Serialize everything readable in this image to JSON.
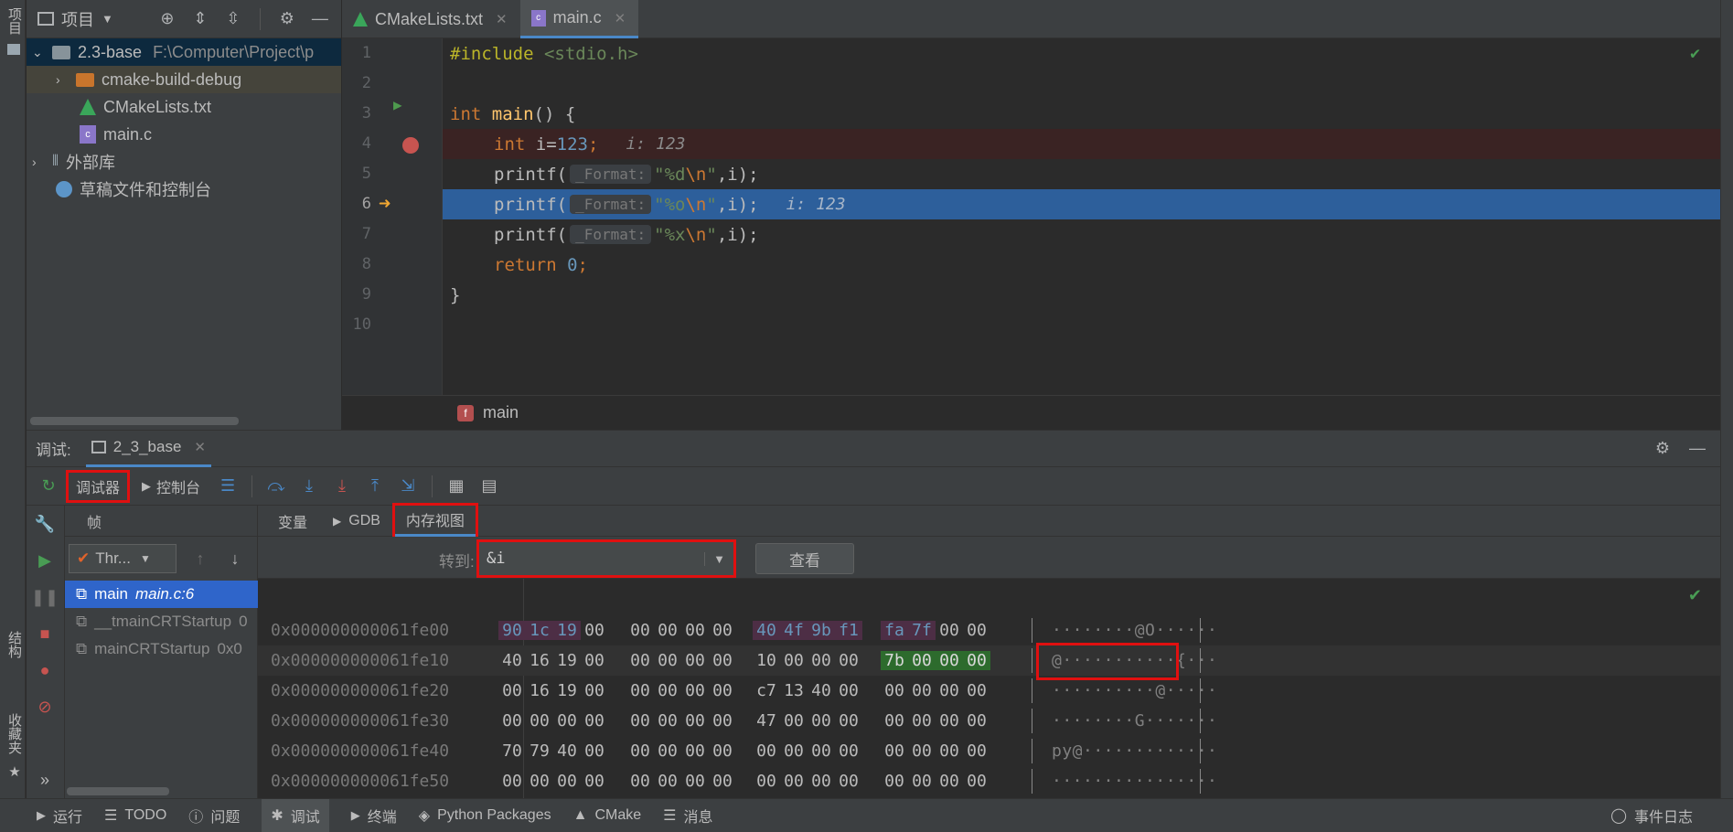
{
  "sidebar_tabs": {
    "project": "项目",
    "structure": "结构",
    "favorites": "收藏夹"
  },
  "project": {
    "title": "项目",
    "tree": [
      {
        "label": "2.3-base",
        "path": "F:\\Computer\\Project\\p"
      },
      {
        "label": "cmake-build-debug"
      },
      {
        "label": "CMakeLists.txt"
      },
      {
        "label": "main.c"
      },
      {
        "label": "外部库"
      },
      {
        "label": "草稿文件和控制台"
      }
    ]
  },
  "editor": {
    "tabs": [
      {
        "label": "CMakeLists.txt"
      },
      {
        "label": "main.c"
      }
    ],
    "line_numbers": [
      "1",
      "2",
      "3",
      "4",
      "5",
      "6",
      "7",
      "8",
      "9",
      "10"
    ],
    "param_hint": "_Format:",
    "inline_i": "i: 123",
    "breadcrumb": "main",
    "code": {
      "l1_dir": "#include ",
      "l1_hdr": "<stdio.h>",
      "l3_kw": "int ",
      "l3_fn": "main",
      "l3_rest": "() {",
      "l4_kw": "int ",
      "l4_var": "i=",
      "l4_num": "123",
      "l4_semi": ";",
      "printf": "printf(",
      "fmt_d": "\"%d",
      "fmt_o": "\"%o",
      "fmt_x": "\"%x",
      "esc_n": "\\n",
      "fmt_close": "\"",
      "args_end": ",i);",
      "ret_kw": "return ",
      "ret_num": "0",
      "ret_semi": ";",
      "close_brace": "}"
    }
  },
  "debug": {
    "label": "调试:",
    "session_tab": "2_3_base",
    "toolbar": {
      "debugger": "调试器",
      "console": "控制台"
    },
    "frames_header": "帧",
    "thread_select": "Thr...",
    "frames": [
      {
        "name": "main",
        "loc": "main.c:6"
      },
      {
        "name": "__tmainCRTStartup",
        "loc": "0"
      },
      {
        "name": "mainCRTStartup",
        "loc": "0x0"
      }
    ],
    "memory_tabs": [
      {
        "label": "变量"
      },
      {
        "label": "GDB"
      },
      {
        "label": "内存视图"
      }
    ],
    "goto_label": "转到:",
    "goto_value": "&i",
    "view_button": "查看",
    "memory_rows": [
      {
        "addr": "0x000000000061fe00",
        "bytes": [
          "90",
          "1c",
          "19",
          "00",
          "00",
          "00",
          "00",
          "00",
          "40",
          "4f",
          "9b",
          "f1",
          "fa",
          "7f",
          "00",
          "00"
        ],
        "ascii": "········@O······"
      },
      {
        "addr": "0x000000000061fe10",
        "bytes": [
          "40",
          "16",
          "19",
          "00",
          "00",
          "00",
          "00",
          "00",
          "10",
          "00",
          "00",
          "00",
          "7b",
          "00",
          "00",
          "00"
        ],
        "ascii": "@···········{···"
      },
      {
        "addr": "0x000000000061fe20",
        "bytes": [
          "00",
          "16",
          "19",
          "00",
          "00",
          "00",
          "00",
          "00",
          "c7",
          "13",
          "40",
          "00",
          "00",
          "00",
          "00",
          "00"
        ],
        "ascii": "··········@·····"
      },
      {
        "addr": "0x000000000061fe30",
        "bytes": [
          "00",
          "00",
          "00",
          "00",
          "00",
          "00",
          "00",
          "00",
          "47",
          "00",
          "00",
          "00",
          "00",
          "00",
          "00",
          "00"
        ],
        "ascii": "········G·······"
      },
      {
        "addr": "0x000000000061fe40",
        "bytes": [
          "70",
          "79",
          "40",
          "00",
          "00",
          "00",
          "00",
          "00",
          "00",
          "00",
          "00",
          "00",
          "00",
          "00",
          "00",
          "00"
        ],
        "ascii": "py@·············"
      },
      {
        "addr": "0x000000000061fe50",
        "bytes": [
          "00",
          "00",
          "00",
          "00",
          "00",
          "00",
          "00",
          "00",
          "00",
          "00",
          "00",
          "00",
          "00",
          "00",
          "00",
          "00"
        ],
        "ascii": "················"
      }
    ]
  },
  "status_bar": {
    "items": [
      {
        "label": "运行"
      },
      {
        "label": "TODO"
      },
      {
        "label": "问题"
      },
      {
        "label": "调试"
      },
      {
        "label": "终端"
      },
      {
        "label": "Python Packages"
      },
      {
        "label": "CMake"
      },
      {
        "label": "消息"
      }
    ],
    "event_log": "事件日志"
  },
  "colors": {
    "accent": "#4a88c7",
    "highlight_box": "#e01010",
    "exec_line": "#2d5f9b"
  }
}
